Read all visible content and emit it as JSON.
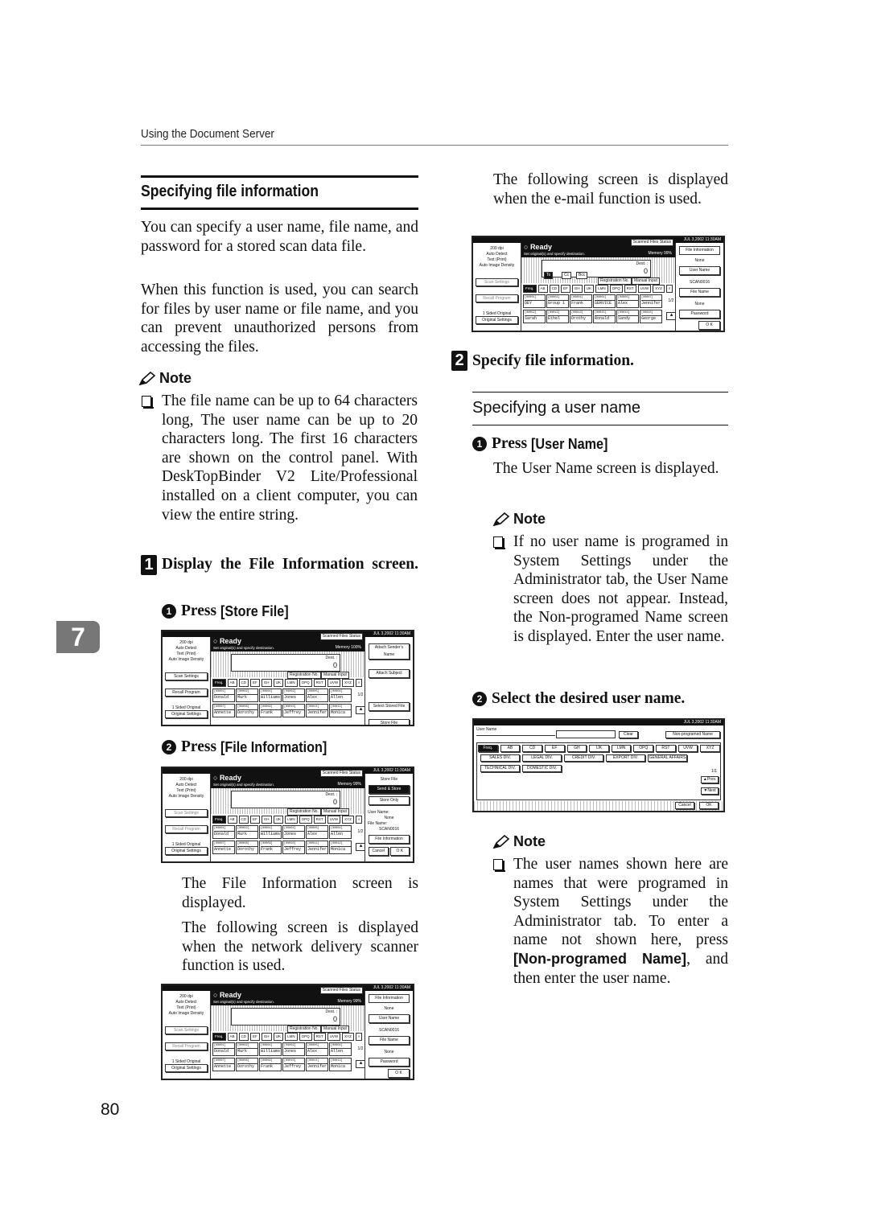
{
  "header": {
    "running_title": "Using the Document Server"
  },
  "chapter_tab": "7",
  "page_number": "80",
  "section": {
    "title": "Specifying file information",
    "intro_1": "You can specify a user name, file name, and password for a stored scan data file.",
    "intro_2": "When this function is used, you can search for files by user name or file name, and you can prevent unauthorized persons from accessing the files.",
    "note_label": "Note",
    "note_1": "The file name can be up to 64 characters long, The user name can be up to 20 characters long. The first 16 characters are shown on the control panel. With DeskTopBinder V2 Lite/Professional installed on a client computer, you can view the entire string."
  },
  "step1": {
    "number": "1",
    "title": "Display the File Information screen.",
    "sub1_num": "1",
    "sub1_prefix": "Press ",
    "sub1_key": "[Store File]",
    "sub2_num": "2",
    "sub2_prefix": "Press ",
    "sub2_key": "[File Information]",
    "result_text": "The File Information screen is displayed.",
    "network_text": "The following screen is displayed when the network delivery scanner function is used."
  },
  "email_text": "The following screen is displayed when the e-mail function is used.",
  "step2": {
    "number": "2",
    "title": "Specify file information.",
    "subheading": "Specifying a user name",
    "sub1_num": "1",
    "sub1_prefix": "Press ",
    "sub1_key": "[User Name]",
    "sub1_result": "The User Name screen is displayed.",
    "note_label": "Note",
    "note_1": "If no user name is programed in System Settings under the Administrator tab, the User Name screen does not appear. Instead, the Non-programed Name screen is displayed. Enter the user name.",
    "sub2_num": "2",
    "sub2_text": "Select the desired user name.",
    "note2_label": "Note",
    "note_2_part1": "The user names shown here are names that were programed in System Settings under the Administrator tab. To enter a name not shown here, press ",
    "note_2_key": "[Non-programed Name]",
    "note_2_part2": ", and then enter the user name."
  },
  "panel_common": {
    "datetime": "JUL   3,2002 11:30AM",
    "left_info": [
      "200 dpi",
      "Auto Detect",
      "Text (Print)",
      "Auto Image Density"
    ],
    "scan_settings": "Scan Settings",
    "recall_program": "Recall Program",
    "original_side": "1 Sided Original",
    "original_settings": "Original Settings",
    "ready": "Ready",
    "ready_sub": "Set original(s) and specify destination.",
    "scanned_files_status": "Scanned Files Status",
    "dest_label": "Dest. :",
    "dest_count": "0",
    "registration_no": "Registration No.",
    "manual_input": "Manual Input",
    "tabs": [
      "Freq.",
      "AB",
      "CD",
      "EF",
      "GH",
      "IJK",
      "LMN",
      "OPQ",
      "RST",
      "UVW",
      "XYZ"
    ],
    "page_indicator": "1/2",
    "cells": [
      {
        "id": "[00001]",
        "name": "Donald"
      },
      {
        "id": "[00002]",
        "name": "Mark"
      },
      {
        "id": "[00004]",
        "name": "Williams"
      },
      {
        "id": "[00002]",
        "name": "Jones"
      },
      {
        "id": "[00005]",
        "name": "Alex"
      },
      {
        "id": "[00004]",
        "name": "Allen"
      },
      {
        "id": "[00007]",
        "name": "Annette"
      },
      {
        "id": "[00008]",
        "name": "Dorothy"
      },
      {
        "id": "[00009]",
        "name": "Frank"
      },
      {
        "id": "[00010]",
        "name": "Jeffrey"
      },
      {
        "id": "[00011]",
        "name": "Jennifer"
      },
      {
        "id": "[00012]",
        "name": "Monica"
      }
    ]
  },
  "panel1": {
    "memory": "Memory 100%",
    "right_buttons": [
      "Attach Sender's Name",
      "Attach Subject",
      "Select Stored File",
      "Store File"
    ]
  },
  "panel2": {
    "memory": "Memory 99%",
    "store_file": "Store File",
    "send_store": "Send & Store",
    "store_only": "Store Only",
    "user_name_label": "User Name:",
    "user_name_value": "None",
    "file_name_label": "File Name:",
    "file_name_value": "SCAN0016",
    "file_information": "File Information",
    "cancel": "Cancel",
    "ok": "O K"
  },
  "panel3": {
    "memory": "Memory 99%",
    "title": "File Information",
    "user_value": "None",
    "user_btn": "User Name",
    "file_value": "SCAN0016",
    "file_btn": "File Name",
    "pw_value": "None",
    "pw_btn": "Password",
    "ok": "O K"
  },
  "panel4": {
    "memory": "Memory 99%",
    "to": "To",
    "cc": "Cc",
    "bcc": "Bcc",
    "title": "File Information",
    "user_value": "None",
    "user_btn": "User Name",
    "file_value": "SCAN0016",
    "file_btn": "File Name",
    "pw_value": "None",
    "pw_btn": "Password",
    "ok": "O K",
    "cells": [
      {
        "id": "[00001]",
        "name": "DEY"
      },
      {
        "id": "[00002]",
        "name": "Group 1"
      },
      {
        "id": "[00004]",
        "name": "Frank"
      },
      {
        "id": "[00001]",
        "name": "SERVICE"
      },
      {
        "id": "[00005]",
        "name": "Alex"
      },
      {
        "id": "[00007]",
        "name": "Jennifer"
      },
      {
        "id": "[00052]",
        "name": "Sarah"
      },
      {
        "id": "[00013]",
        "name": "Ethel"
      },
      {
        "id": "[00013]",
        "name": "Drothy"
      },
      {
        "id": "[00015]",
        "name": "Ronald"
      },
      {
        "id": "[00014]",
        "name": "Sandy"
      },
      {
        "id": "[00015]",
        "name": "George"
      }
    ]
  },
  "panel5": {
    "datetime": "JUL   3,2002 11:30AM",
    "label": "User Name",
    "input_value": "",
    "clear": "Clear",
    "non_programed": "Non-programed Name",
    "tabs": [
      "Freq.",
      "AB",
      "CD",
      "EF",
      "GH",
      "IJK",
      "LMN",
      "OPQ",
      "RST",
      "UVW",
      "XYZ"
    ],
    "names": [
      "SALES DIV.",
      "LEGAL DIV.",
      "CREDIT DIV.",
      "EXPORT DIV.",
      "GENERAL AFFAIRS",
      "TECHNICAL DIV.",
      "DOMESTIC DIV."
    ],
    "page": "1/1",
    "prev": "▲Prev.",
    "next": "▼Next",
    "cancel": "Cancel",
    "ok": "OK"
  }
}
